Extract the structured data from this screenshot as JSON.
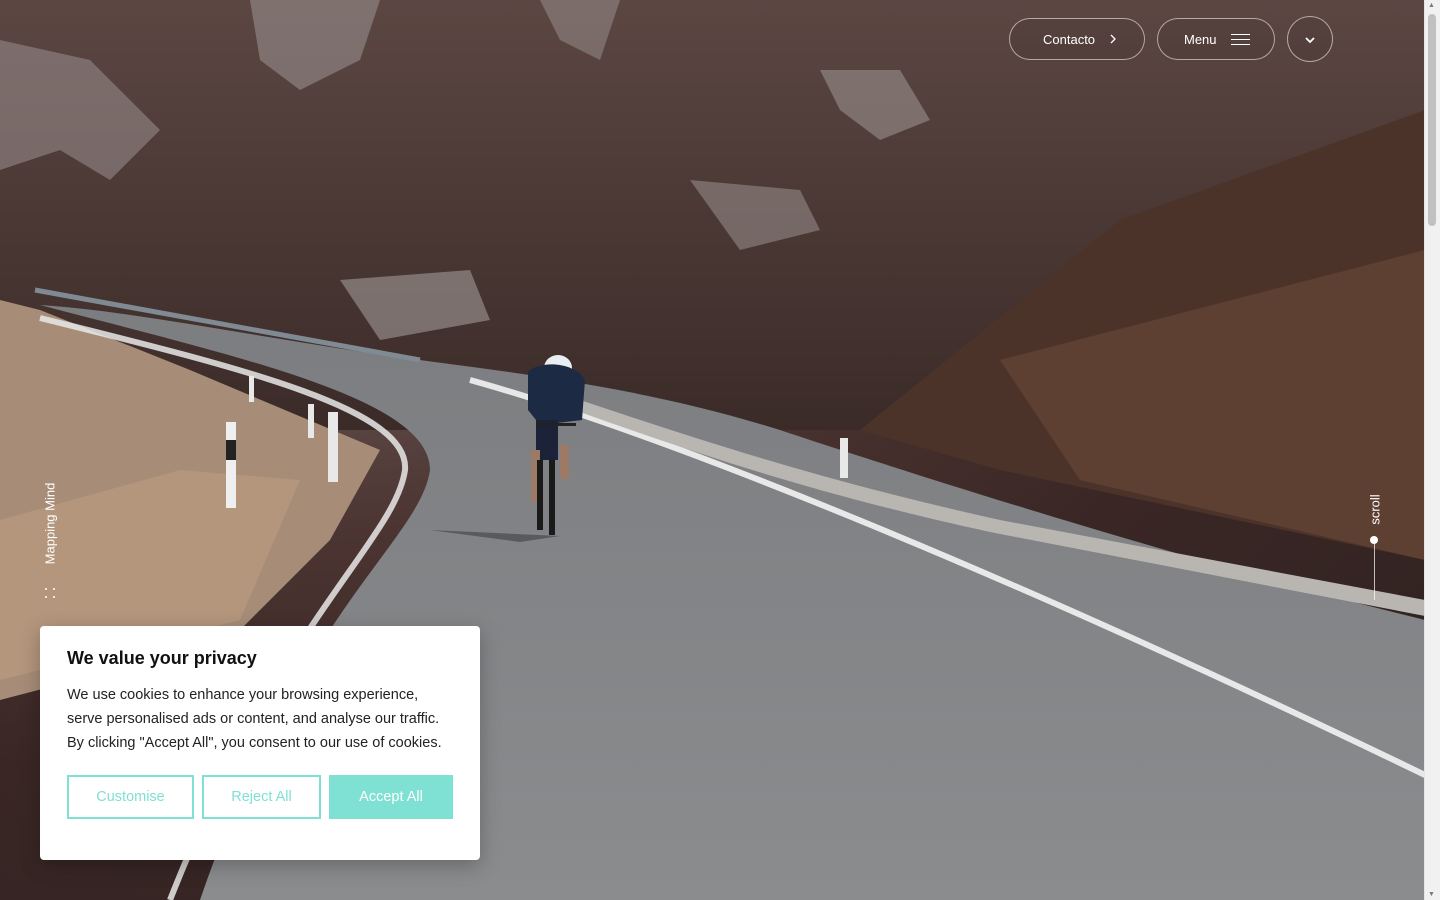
{
  "header": {
    "contact_label": "Contacto",
    "menu_label": "Menu"
  },
  "side": {
    "left_label": "Mapping Mind",
    "right_label": "scroll"
  },
  "cookie": {
    "title": "We value your privacy",
    "body": "We use cookies to enhance your browsing experience, serve personalised ads or content, and analyse our traffic. By clicking \"Accept All\", you consent to our use of cookies.",
    "customise_label": "Customise",
    "reject_label": "Reject All",
    "accept_label": "Accept All"
  },
  "colors": {
    "accent": "#7fe0d4"
  },
  "icons": [
    "chevron-right-icon",
    "hamburger-icon",
    "chevron-down-icon"
  ]
}
